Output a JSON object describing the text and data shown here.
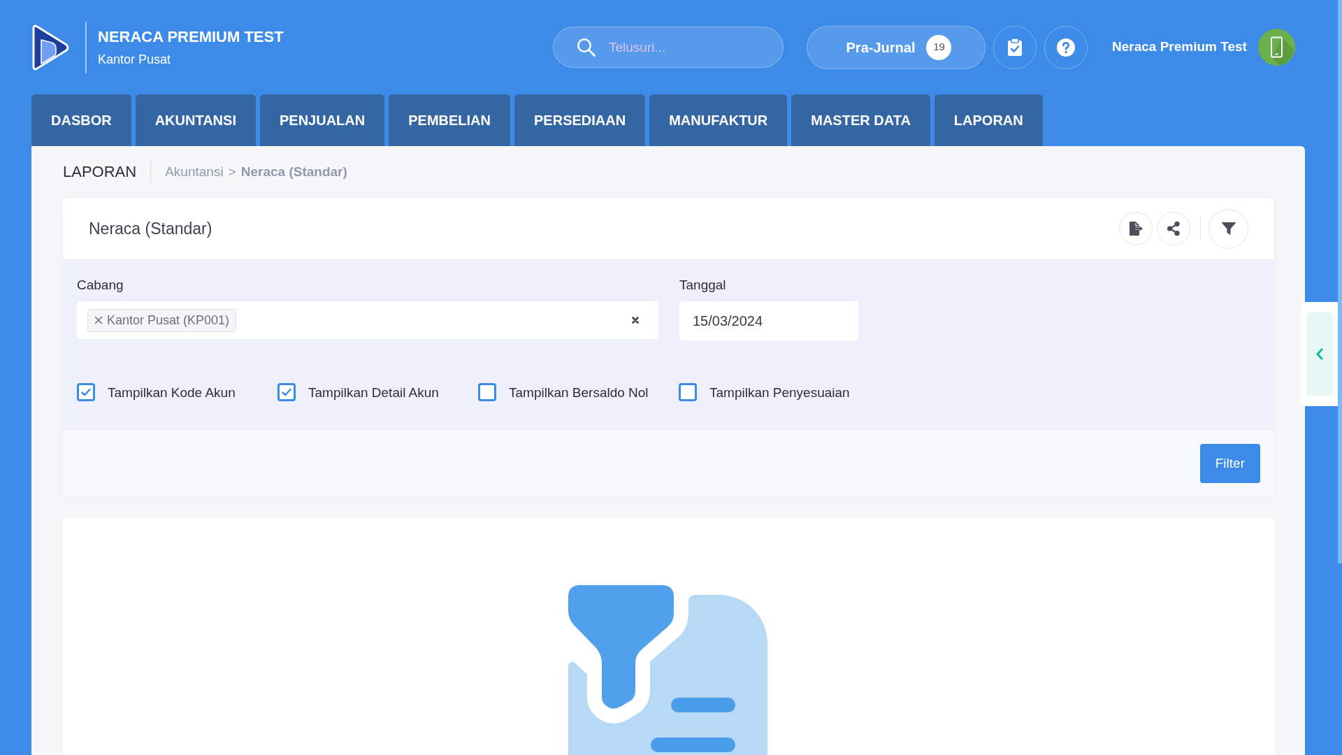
{
  "header": {
    "brand": {
      "title": "NERACA PREMIUM TEST",
      "subtitle": "Kantor Pusat"
    },
    "search": {
      "placeholder": "Telusuri..."
    },
    "pre_journal": {
      "label": "Pra-Jurnal",
      "count": "19"
    },
    "user": {
      "name": "Neraca Premium Test"
    }
  },
  "tabs": [
    {
      "label": "DASBOR",
      "selected": false
    },
    {
      "label": "AKUNTANSI",
      "selected": false
    },
    {
      "label": "PENJUALAN",
      "selected": false
    },
    {
      "label": "PEMBELIAN",
      "selected": false
    },
    {
      "label": "PERSEDIAAN",
      "selected": false
    },
    {
      "label": "MANUFAKTUR",
      "selected": false
    },
    {
      "label": "MASTER DATA",
      "selected": false
    },
    {
      "label": "LAPORAN",
      "selected": false
    }
  ],
  "breadcrumb": {
    "section": "LAPORAN",
    "separator": ">",
    "items": [
      {
        "label": "Akuntansi",
        "active": false
      },
      {
        "label": "Neraca (Standar)",
        "active": true
      }
    ]
  },
  "report_card": {
    "title": "Neraca (Standar)",
    "fields": [
      {
        "kind": "multiselect",
        "label": "Cabang",
        "tags": [
          "Kantor Pusat (KP001)"
        ]
      },
      {
        "kind": "date",
        "label": "Tanggal",
        "value": "15/03/2024"
      }
    ],
    "options": [
      {
        "label": "Tampilkan Kode Akun",
        "checked": true
      },
      {
        "label": "Tampilkan Detail Akun",
        "checked": true
      },
      {
        "label": "Tampilkan Bersaldo Nol",
        "checked": false
      },
      {
        "label": "Tampilkan Penyesuaian",
        "checked": false
      }
    ],
    "submit": "Filter"
  }
}
